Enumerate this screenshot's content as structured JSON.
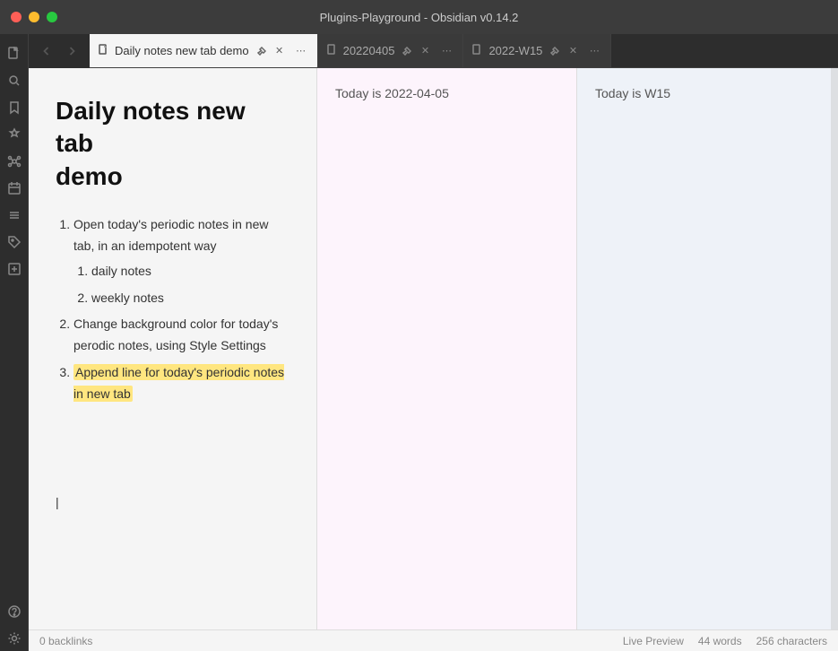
{
  "titlebar": {
    "title": "Plugins-Playground - Obsidian v0.14.2"
  },
  "sidebar": {
    "icons": [
      {
        "name": "files-icon",
        "symbol": "📄"
      },
      {
        "name": "search-icon",
        "symbol": "🔍"
      },
      {
        "name": "bookmark-icon",
        "symbol": "🔖"
      },
      {
        "name": "plugins-icon",
        "symbol": "✦"
      },
      {
        "name": "graph-icon",
        "symbol": "⬡"
      },
      {
        "name": "calendar-icon",
        "symbol": "📅"
      },
      {
        "name": "list-icon",
        "symbol": "≡"
      },
      {
        "name": "tag-icon",
        "symbol": "🏷"
      },
      {
        "name": "review-icon",
        "symbol": "◫"
      },
      {
        "name": "help-icon",
        "symbol": "?"
      },
      {
        "name": "settings-icon",
        "symbol": "⚙"
      }
    ]
  },
  "tabs": [
    {
      "id": "tab-main",
      "label": "Daily notes new tab demo",
      "icon": "📄",
      "active": true
    },
    {
      "id": "tab-daily",
      "label": "20220405",
      "icon": "📄",
      "active": false
    },
    {
      "id": "tab-weekly",
      "label": "2022-W15",
      "icon": "📄",
      "active": false
    }
  ],
  "panes": [
    {
      "id": "pane-main",
      "header": "Daily notes new tab demo",
      "note_title": "Daily notes new tab demo",
      "content_type": "main"
    },
    {
      "id": "pane-daily",
      "header": "20220405",
      "content_type": "daily",
      "text": "Today is 2022-04-05"
    },
    {
      "id": "pane-weekly",
      "header": "2022-W15",
      "content_type": "weekly",
      "text": "Today is W15"
    }
  ],
  "note": {
    "title": "Daily notes new tab\ndemo",
    "items": [
      {
        "text": "Open today's periodic notes in new tab, in an idempotent way",
        "children": [
          "daily notes",
          "weekly notes"
        ]
      },
      {
        "text": "Change background color for today's perodic notes, using Style Settings",
        "children": []
      },
      {
        "text_plain": "Append line for today's periodic notes in ",
        "text_highlight": "new tab",
        "highlighted": true,
        "full_highlight": "Append line for today's periodic notes in new tab",
        "children": []
      }
    ]
  },
  "statusbar": {
    "backlinks": "0 backlinks",
    "mode": "Live Preview",
    "words": "44 words",
    "characters": "256 characters"
  }
}
